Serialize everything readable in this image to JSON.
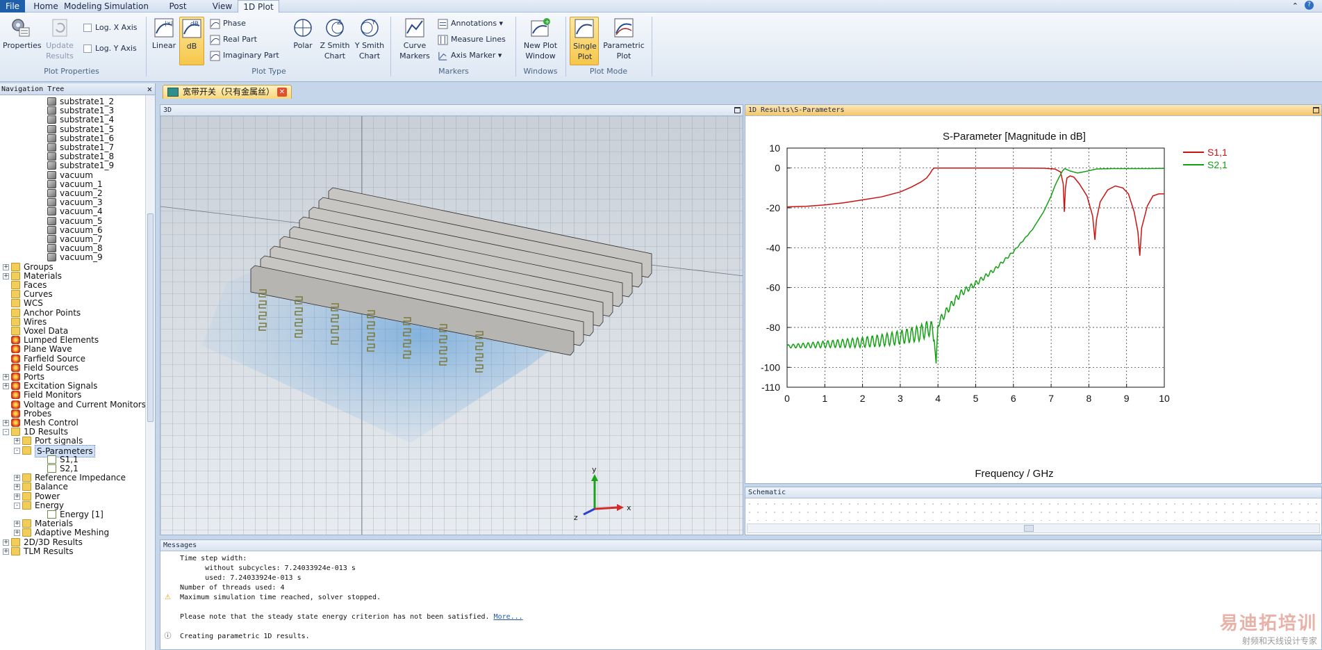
{
  "menu": {
    "tabs": [
      "File",
      "Home",
      "Modeling",
      "Simulation",
      "Post Processing",
      "View",
      "1D Plot"
    ],
    "active": "1D Plot"
  },
  "ribbon": {
    "plot_properties": {
      "label": "Plot Properties",
      "properties": "Properties",
      "update_results": "Update Results",
      "log_x": "Log. X Axis",
      "log_y": "Log. Y Axis"
    },
    "plot_type": {
      "label": "Plot Type",
      "linear": "Linear",
      "db": "dB",
      "phase": "Phase",
      "real_part": "Real Part",
      "imaginary_part": "Imaginary Part",
      "polar": "Polar",
      "z_smith": "Z Smith Chart",
      "y_smith": "Y Smith Chart"
    },
    "markers": {
      "label": "Markers",
      "curve_markers": "Curve Markers",
      "annotations": "Annotations",
      "measure_lines": "Measure Lines",
      "axis_marker": "Axis Marker"
    },
    "windows": {
      "label": "Windows",
      "new_plot_window": "New Plot Window"
    },
    "plot_mode": {
      "label": "Plot Mode",
      "single_plot": "Single Plot",
      "parametric_plot": "Parametric Plot"
    }
  },
  "nav": {
    "title": "Navigation Tree",
    "items": [
      {
        "label": "substrate1_2",
        "indent": 2,
        "icon": "obj",
        "pm": ""
      },
      {
        "label": "substrate1_3",
        "indent": 2,
        "icon": "obj",
        "pm": ""
      },
      {
        "label": "substrate1_4",
        "indent": 2,
        "icon": "obj",
        "pm": ""
      },
      {
        "label": "substrate1_5",
        "indent": 2,
        "icon": "obj",
        "pm": ""
      },
      {
        "label": "substrate1_6",
        "indent": 2,
        "icon": "obj",
        "pm": ""
      },
      {
        "label": "substrate1_7",
        "indent": 2,
        "icon": "obj",
        "pm": ""
      },
      {
        "label": "substrate1_8",
        "indent": 2,
        "icon": "obj",
        "pm": ""
      },
      {
        "label": "substrate1_9",
        "indent": 2,
        "icon": "obj",
        "pm": ""
      },
      {
        "label": "vacuum",
        "indent": 2,
        "icon": "obj",
        "pm": ""
      },
      {
        "label": "vacuum_1",
        "indent": 2,
        "icon": "obj",
        "pm": ""
      },
      {
        "label": "vacuum_2",
        "indent": 2,
        "icon": "obj",
        "pm": ""
      },
      {
        "label": "vacuum_3",
        "indent": 2,
        "icon": "obj",
        "pm": ""
      },
      {
        "label": "vacuum_4",
        "indent": 2,
        "icon": "obj",
        "pm": ""
      },
      {
        "label": "vacuum_5",
        "indent": 2,
        "icon": "obj",
        "pm": ""
      },
      {
        "label": "vacuum_6",
        "indent": 2,
        "icon": "obj",
        "pm": ""
      },
      {
        "label": "vacuum_7",
        "indent": 2,
        "icon": "obj",
        "pm": ""
      },
      {
        "label": "vacuum_8",
        "indent": 2,
        "icon": "obj",
        "pm": ""
      },
      {
        "label": "vacuum_9",
        "indent": 2,
        "icon": "obj",
        "pm": ""
      },
      {
        "label": "Groups",
        "indent": 0,
        "icon": "folder",
        "pm": "+"
      },
      {
        "label": "Materials",
        "indent": 0,
        "icon": "folder",
        "pm": "+"
      },
      {
        "label": "Faces",
        "indent": 0,
        "icon": "folder",
        "pm": ""
      },
      {
        "label": "Curves",
        "indent": 0,
        "icon": "folder",
        "pm": ""
      },
      {
        "label": "WCS",
        "indent": 0,
        "icon": "folder",
        "pm": ""
      },
      {
        "label": "Anchor Points",
        "indent": 0,
        "icon": "folder",
        "pm": ""
      },
      {
        "label": "Wires",
        "indent": 0,
        "icon": "folder",
        "pm": ""
      },
      {
        "label": "Voxel Data",
        "indent": 0,
        "icon": "folder",
        "pm": ""
      },
      {
        "label": "Lumped Elements",
        "indent": 0,
        "icon": "red",
        "pm": ""
      },
      {
        "label": "Plane Wave",
        "indent": 0,
        "icon": "red",
        "pm": ""
      },
      {
        "label": "Farfield Source",
        "indent": 0,
        "icon": "red",
        "pm": ""
      },
      {
        "label": "Field Sources",
        "indent": 0,
        "icon": "red",
        "pm": ""
      },
      {
        "label": "Ports",
        "indent": 0,
        "icon": "red",
        "pm": "+"
      },
      {
        "label": "Excitation Signals",
        "indent": 0,
        "icon": "red",
        "pm": "+"
      },
      {
        "label": "Field Monitors",
        "indent": 0,
        "icon": "red",
        "pm": ""
      },
      {
        "label": "Voltage and Current Monitors",
        "indent": 0,
        "icon": "red",
        "pm": ""
      },
      {
        "label": "Probes",
        "indent": 0,
        "icon": "red",
        "pm": ""
      },
      {
        "label": "Mesh Control",
        "indent": 0,
        "icon": "red",
        "pm": "+"
      },
      {
        "label": "1D Results",
        "indent": 0,
        "icon": "folder",
        "pm": "-"
      },
      {
        "label": "Port signals",
        "indent": 1,
        "icon": "folder",
        "pm": "+"
      },
      {
        "label": "S-Parameters",
        "indent": 1,
        "icon": "folder",
        "pm": "-",
        "selected": true
      },
      {
        "label": "S1,1",
        "indent": 2,
        "icon": "curve",
        "pm": ""
      },
      {
        "label": "S2,1",
        "indent": 2,
        "icon": "curve",
        "pm": ""
      },
      {
        "label": "Reference Impedance",
        "indent": 1,
        "icon": "folder",
        "pm": "+"
      },
      {
        "label": "Balance",
        "indent": 1,
        "icon": "folder",
        "pm": "+"
      },
      {
        "label": "Power",
        "indent": 1,
        "icon": "folder",
        "pm": "+"
      },
      {
        "label": "Energy",
        "indent": 1,
        "icon": "folder",
        "pm": "-"
      },
      {
        "label": "Energy [1]",
        "indent": 2,
        "icon": "curve",
        "pm": ""
      },
      {
        "label": "Materials",
        "indent": 1,
        "icon": "folder",
        "pm": "+"
      },
      {
        "label": "Adaptive Meshing",
        "indent": 1,
        "icon": "folder",
        "pm": "+"
      },
      {
        "label": "2D/3D Results",
        "indent": 0,
        "icon": "folder",
        "pm": "+"
      },
      {
        "label": "TLM Results",
        "indent": 0,
        "icon": "folder",
        "pm": "+"
      }
    ]
  },
  "doc_tab": {
    "label": "宽带开关（只有金属丝）"
  },
  "view3d": {
    "title": "3D",
    "axes": {
      "x": "x",
      "y": "y",
      "z": "z"
    }
  },
  "view1d": {
    "title": "1D Results\\S-Parameters"
  },
  "schematic": {
    "title": "Schematic"
  },
  "messages": {
    "title": "Messages",
    "lines": [
      {
        "text": "Time step width:",
        "icon": ""
      },
      {
        "text": "      without subcycles: 7.24033924e-013 s",
        "icon": ""
      },
      {
        "text": "      used: 7.24033924e-013 s",
        "icon": ""
      },
      {
        "text": "Number of threads used: 4",
        "icon": ""
      },
      {
        "text": "Maximum simulation time reached, solver stopped.",
        "icon": "warning"
      },
      {
        "text": "",
        "icon": ""
      },
      {
        "text": "Please note that the steady state energy criterion has not been satisfied.",
        "icon": "",
        "more": "More..."
      },
      {
        "text": "",
        "icon": ""
      },
      {
        "text": "Creating parametric 1D results.",
        "icon": "info"
      }
    ]
  },
  "watermark": {
    "line1": "易迪拓培训",
    "line2": "射频和天线设计专家"
  },
  "colors": {
    "s11": "#cc1111",
    "s21": "#11a011",
    "accent": "#1f5ea8"
  },
  "chart_data": {
    "type": "line",
    "title": "S-Parameter [Magnitude in dB]",
    "xlabel": "Frequency / GHz",
    "ylabel": "",
    "xlim": [
      0,
      10
    ],
    "ylim": [
      -110,
      10
    ],
    "xticks": [
      0,
      1,
      2,
      3,
      4,
      5,
      6,
      7,
      8,
      9,
      10
    ],
    "yticks": [
      10,
      0,
      -20,
      -40,
      -60,
      -80,
      -100,
      -110
    ],
    "grid": true,
    "legend": "right",
    "series": [
      {
        "name": "S1,1",
        "color": "#cc1111",
        "x": [
          0,
          0.5,
          1,
          1.5,
          2,
          2.5,
          3,
          3.3,
          3.55,
          3.7,
          3.8,
          3.85,
          3.9,
          4,
          5,
          6,
          6.8,
          7.1,
          7.25,
          7.32,
          7.35,
          7.38,
          7.42,
          7.5,
          7.6,
          7.75,
          7.95,
          8.1,
          8.16,
          8.2,
          8.3,
          8.5,
          8.7,
          8.9,
          9.05,
          9.2,
          9.3,
          9.35,
          9.4,
          9.55,
          9.7,
          9.85,
          10
        ],
        "y": [
          -19.5,
          -19.2,
          -18.5,
          -17.5,
          -16,
          -14.5,
          -12,
          -9.5,
          -7,
          -5,
          -2.5,
          -0.8,
          0,
          0,
          0,
          0,
          -0.1,
          -0.5,
          -2,
          -8,
          -22,
          -10,
          -5,
          -4,
          -4.5,
          -8,
          -14,
          -24,
          -36,
          -26,
          -17,
          -11,
          -9,
          -10,
          -13,
          -22,
          -32,
          -44,
          -30,
          -19,
          -14,
          -13,
          -13
        ]
      },
      {
        "name": "S2,1",
        "color": "#11a011",
        "x": [
          0,
          0.5,
          1,
          1.5,
          2,
          2.5,
          3,
          3.5,
          3.8,
          3.9,
          3.95,
          4,
          4.3,
          4.6,
          5,
          5.5,
          6,
          6.5,
          6.8,
          7,
          7.1,
          7.2,
          7.3,
          7.36,
          7.5,
          7.7,
          7.9,
          8.2,
          8.6,
          9,
          9.5,
          10
        ],
        "y": [
          -89.5,
          -89,
          -88.5,
          -88,
          -87.5,
          -86.5,
          -85,
          -83,
          -80,
          -84,
          -100,
          -78,
          -70,
          -63,
          -58,
          -51,
          -42,
          -31,
          -22,
          -14,
          -9,
          -5,
          -1.5,
          -0.3,
          -1.5,
          -2.5,
          -1.8,
          -0.5,
          -0.3,
          -0.3,
          -0.3,
          -0.2
        ]
      }
    ]
  }
}
